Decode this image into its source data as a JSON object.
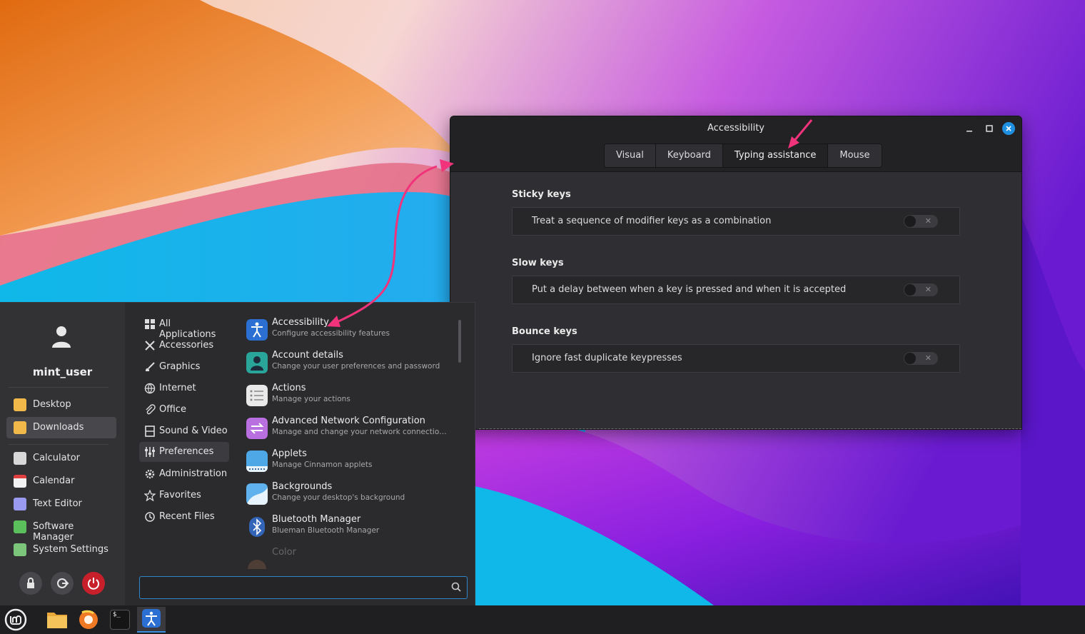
{
  "window": {
    "title": "Accessibility",
    "controls": [
      "minimize-icon",
      "maximize-icon",
      "close-icon"
    ],
    "tabs": [
      {
        "label": "Visual",
        "active": false
      },
      {
        "label": "Keyboard",
        "active": false
      },
      {
        "label": "Typing assistance",
        "active": true
      },
      {
        "label": "Mouse",
        "active": false
      }
    ],
    "sections": [
      {
        "title": "Sticky keys",
        "option": "Treat a sequence of modifier keys as a combination",
        "enabled": false
      },
      {
        "title": "Slow keys",
        "option": "Put a delay between when a key is pressed and when it is accepted",
        "enabled": false
      },
      {
        "title": "Bounce keys",
        "option": "Ignore fast duplicate keypresses",
        "enabled": false
      }
    ],
    "switch_off_glyph": "✕"
  },
  "menu": {
    "username": "mint_user",
    "places": [
      {
        "label": "Desktop",
        "icon": "folder-icon"
      },
      {
        "label": "Downloads",
        "icon": "download-folder-icon",
        "selected": true
      }
    ],
    "favorites": [
      {
        "label": "Calculator",
        "icon": "calculator-icon"
      },
      {
        "label": "Calendar",
        "icon": "calendar-icon"
      },
      {
        "label": "Text Editor",
        "icon": "text-editor-icon"
      },
      {
        "label": "Software Manager",
        "icon": "software-manager-icon"
      },
      {
        "label": "System Settings",
        "icon": "settings-icon"
      }
    ],
    "categories": [
      {
        "label": "All Applications",
        "icon": "grid-icon"
      },
      {
        "label": "Accessories",
        "icon": "tools-icon"
      },
      {
        "label": "Graphics",
        "icon": "brush-icon"
      },
      {
        "label": "Internet",
        "icon": "globe-icon"
      },
      {
        "label": "Office",
        "icon": "paperclip-icon"
      },
      {
        "label": "Sound & Video",
        "icon": "film-icon"
      },
      {
        "label": "Preferences",
        "icon": "sliders-icon",
        "selected": true
      },
      {
        "label": "Administration",
        "icon": "gear-icon"
      },
      {
        "label": "Favorites",
        "icon": "star-icon"
      },
      {
        "label": "Recent Files",
        "icon": "history-icon"
      }
    ],
    "apps": [
      {
        "name": "Accessibility",
        "desc": "Configure accessibility features",
        "color": "#2a6fd1"
      },
      {
        "name": "Account details",
        "desc": "Change your user preferences and password",
        "color": "#2aa59a"
      },
      {
        "name": "Actions",
        "desc": "Manage your actions",
        "color": "#e9e9e9"
      },
      {
        "name": "Advanced Network Configuration",
        "desc": "Manage and change your network connection se…",
        "color": "#b86fe0"
      },
      {
        "name": "Applets",
        "desc": "Manage Cinnamon applets",
        "color": "#4ea8e6"
      },
      {
        "name": "Backgrounds",
        "desc": "Change your desktop's background",
        "color": "#5fb2ee"
      },
      {
        "name": "Bluetooth Manager",
        "desc": "Blueman Bluetooth Manager",
        "color": "#3264b8"
      },
      {
        "name": "Color",
        "desc": "",
        "color": "#a36a4a"
      }
    ],
    "search": {
      "value": "",
      "placeholder": ""
    },
    "system_buttons": [
      "lock-icon",
      "logout-icon",
      "power-icon"
    ]
  },
  "taskbar": {
    "items": [
      {
        "icon": "mint-menu-icon"
      },
      {
        "icon": "files-icon"
      },
      {
        "icon": "firefox-icon"
      },
      {
        "icon": "terminal-icon",
        "text": "$_"
      },
      {
        "icon": "accessibility-app-icon",
        "active": true
      }
    ]
  },
  "colors": {
    "accent": "#2e86c9",
    "annotation_arrow": "#f0337a",
    "power": "#c8202a"
  }
}
